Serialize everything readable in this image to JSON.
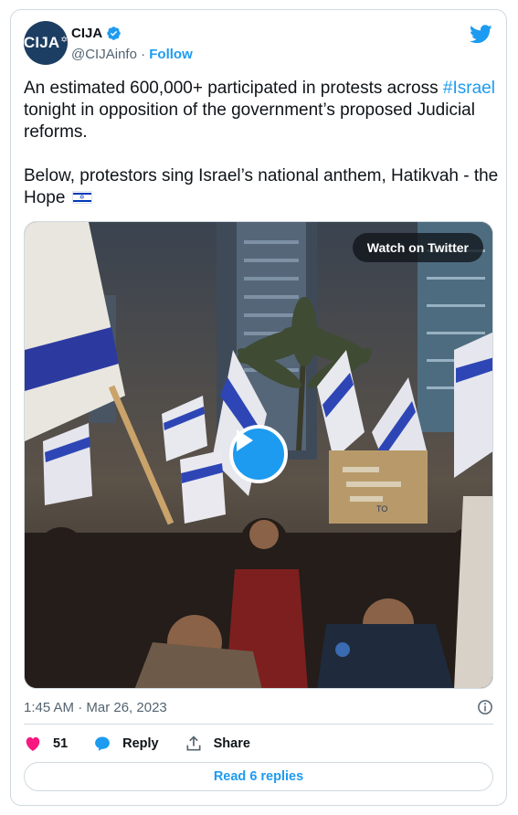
{
  "author": {
    "avatar_text": "CIJA",
    "display_name": "CIJA",
    "handle": "@CIJAinfo",
    "separator": "·",
    "follow_label": "Follow",
    "verified": true
  },
  "tweet": {
    "text_part1": "An estimated 600,000+ participated in protests across ",
    "hashtag": "#Israel",
    "text_part2": " tonight in opposition of the government’s proposed Judicial reforms.",
    "text_para2": "Below, protestors sing Israel’s national anthem, Hatikvah - the Hope",
    "flag_emoji": "israel-flag"
  },
  "media": {
    "type": "video",
    "watch_label": "Watch on Twitter",
    "sign_text": "TO"
  },
  "meta": {
    "timestamp": "1:45 AM · Mar 26, 2023"
  },
  "actions": {
    "like_count": "51",
    "reply_label": "Reply",
    "share_label": "Share"
  },
  "footer": {
    "read_replies_label": "Read 6 replies"
  },
  "colors": {
    "brand_blue": "#1d9bf0",
    "like_pink": "#f91880",
    "avatar_navy": "#1d3e63",
    "text_gray": "#536471"
  }
}
